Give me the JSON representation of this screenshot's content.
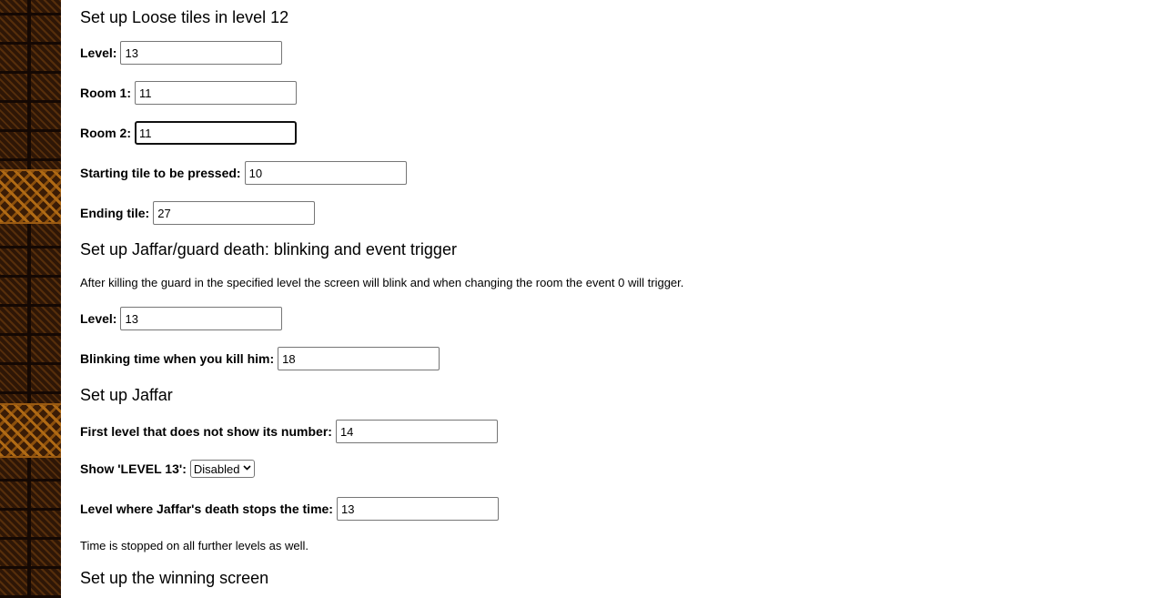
{
  "sections": {
    "loose": {
      "heading": "Set up Loose tiles in level 12",
      "level_label": "Level:",
      "level_value": "13",
      "room1_label": "Room 1:",
      "room1_value": "11",
      "room2_label": "Room 2:",
      "room2_value": "11",
      "start_label": "Starting tile to be pressed:",
      "start_value": "10",
      "end_label": "Ending tile:",
      "end_value": "27"
    },
    "guard": {
      "heading": "Set up Jaffar/guard death: blinking and event trigger",
      "description": "After killing the guard in the specified level the screen will blink and when changing the room the event 0 will trigger.",
      "level_label": "Level:",
      "level_value": "13",
      "blink_label": "Blinking time when you kill him:",
      "blink_value": "18"
    },
    "jaffar": {
      "heading": "Set up Jaffar",
      "first_level_label": "First level that does not show its number:",
      "first_level_value": "14",
      "show13_label": "Show 'LEVEL 13':",
      "show13_value": "Disabled",
      "stop_label": "Level where Jaffar's death stops the time:",
      "stop_value": "13",
      "note": "Time is stopped on all further levels as well."
    },
    "winning": {
      "heading": "Set up the winning screen"
    }
  },
  "icons": {
    "dropdown": "chevron-down-icon"
  }
}
